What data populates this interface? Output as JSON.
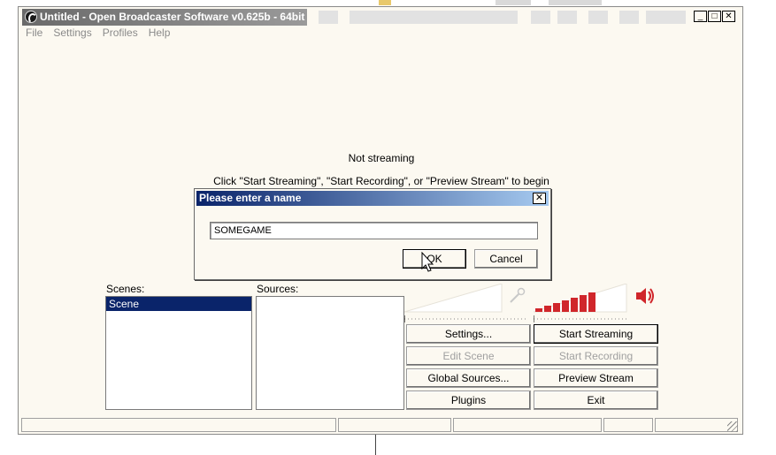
{
  "window": {
    "title": "Untitled - Open Broadcaster Software v0.625b - 64bit",
    "minimize": "_",
    "maximize": "□",
    "close": "✕"
  },
  "menu": [
    "File",
    "Settings",
    "Profiles",
    "Help"
  ],
  "status": {
    "line1": "Not streaming",
    "line2": "Click \"Start Streaming\", \"Start Recording\", or \"Preview Stream\" to begin"
  },
  "scenes": {
    "label": "Scenes:",
    "items": [
      "Scene"
    ]
  },
  "sources": {
    "label": "Sources:"
  },
  "buttons": {
    "settings": "Settings...",
    "start_streaming": "Start Streaming",
    "edit_scene": "Edit Scene",
    "start_recording": "Start Recording",
    "global_sources": "Global Sources...",
    "preview_stream": "Preview Stream",
    "plugins": "Plugins",
    "exit": "Exit"
  },
  "dialog": {
    "title": "Please enter a name",
    "close": "✕",
    "value": "SOMEGAME",
    "ok": "OK",
    "cancel": "Cancel"
  },
  "icons": {
    "mic": "microphone-icon",
    "speaker": "speaker-icon",
    "app": "obs-logo-icon"
  },
  "colors": {
    "dialog_title_start": "#0a246a",
    "dialog_title_end": "#a6caf0",
    "volume_bar": "#d0262b",
    "speaker": "#d0262b",
    "selection": "#0a246a"
  }
}
